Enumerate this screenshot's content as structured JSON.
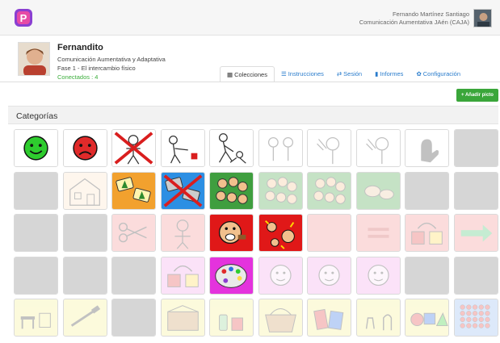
{
  "header": {
    "user_name": "Fernando Martínez Santiago",
    "user_org": "Comunicación Aumentativa JAén (CAJA)"
  },
  "profile": {
    "name": "Fernandito",
    "communication": "Comunicación Aumentativa y Adaptativa",
    "phase": "Fase 1 - El intercambio físico",
    "connected": "Conectados : 4"
  },
  "tabs": [
    {
      "label": "Colecciones",
      "icon": "grid-icon"
    },
    {
      "label": "Instrucciones",
      "icon": "list-icon"
    },
    {
      "label": "Sesión",
      "icon": "exchange-icon"
    },
    {
      "label": "Informes",
      "icon": "file-icon"
    },
    {
      "label": "Configuración",
      "icon": "gear-icon"
    }
  ],
  "add_button": "+ Añadir picto",
  "categories_title": "Categorías",
  "colors": {
    "accent_blue": "#2a7ccc",
    "add_green": "#3aa63a",
    "connected_green": "#3cae3c"
  },
  "grid": [
    [
      {
        "name": "happy-face-picto",
        "bg": "#ffffff",
        "icon": "happy",
        "faded": false
      },
      {
        "name": "sad-face-picto",
        "bg": "#ffffff",
        "icon": "sad",
        "faded": false
      },
      {
        "name": "no-picto",
        "bg": "#ffffff",
        "icon": "crossed-person",
        "faded": false
      },
      {
        "name": "give-picto",
        "bg": "#ffffff",
        "icon": "person-give",
        "faded": false
      },
      {
        "name": "help-picto",
        "bg": "#ffffff",
        "icon": "people-help",
        "faded": false
      },
      {
        "name": "faded-people-picto",
        "bg": "#ffffff",
        "icon": "people",
        "faded": true
      },
      {
        "name": "faded-hello-picto",
        "bg": "#ffffff",
        "icon": "wave",
        "faded": true
      },
      {
        "name": "faded-bye-picto",
        "bg": "#ffffff",
        "icon": "wave",
        "faded": true
      },
      {
        "name": "faded-hand-picto",
        "bg": "#ffffff",
        "icon": "hand",
        "faded": true
      },
      {
        "name": "empty-picto",
        "bg": "#d6d6d6",
        "icon": "none",
        "faded": false
      }
    ],
    [
      {
        "name": "empty-picto",
        "bg": "#d6d6d6",
        "icon": "none",
        "faded": false
      },
      {
        "name": "faded-house-picto",
        "bg": "#fbe0c2",
        "icon": "house",
        "faded": true
      },
      {
        "name": "trees-picto",
        "bg": "#f2a12e",
        "icon": "trees",
        "faded": false
      },
      {
        "name": "no-nature-picto",
        "bg": "#2c8fe3",
        "icon": "crossed-trees",
        "faded": false
      },
      {
        "name": "group-faces-picto",
        "bg": "#3f9e3f",
        "icon": "faces",
        "faded": false
      },
      {
        "name": "faded-group-picto",
        "bg": "#3f9e3f",
        "icon": "faces",
        "faded": true
      },
      {
        "name": "faded-crowd-picto",
        "bg": "#3f9e3f",
        "icon": "faces",
        "faded": true
      },
      {
        "name": "faded-animals-picto",
        "bg": "#3f9e3f",
        "icon": "animals",
        "faded": true
      },
      {
        "name": "empty-picto",
        "bg": "#d6d6d6",
        "icon": "none",
        "faded": false
      },
      {
        "name": "empty-picto",
        "bg": "#d6d6d6",
        "icon": "none",
        "faded": false
      }
    ],
    [
      {
        "name": "empty-picto",
        "bg": "#d6d6d6",
        "icon": "none",
        "faded": false
      },
      {
        "name": "empty-picto",
        "bg": "#d6d6d6",
        "icon": "none",
        "faded": false
      },
      {
        "name": "faded-scissors-picto",
        "bg": "#f08c8c",
        "icon": "scissors",
        "faded": true
      },
      {
        "name": "faded-person-picto",
        "bg": "#f08c8c",
        "icon": "person",
        "faded": true
      },
      {
        "name": "eat-picto",
        "bg": "#e01818",
        "icon": "eat",
        "faded": false
      },
      {
        "name": "angry-picto",
        "bg": "#e01818",
        "icon": "angry",
        "faded": false
      },
      {
        "name": "faded-red-picto",
        "bg": "#f08c8c",
        "icon": "none",
        "faded": true
      },
      {
        "name": "faded-equal-picto",
        "bg": "#f08c8c",
        "icon": "equal",
        "faded": true
      },
      {
        "name": "faded-change-picto",
        "bg": "#f08c8c",
        "icon": "squares",
        "faded": true
      },
      {
        "name": "faded-arrow-picto",
        "bg": "#f08c8c",
        "icon": "arrow",
        "faded": true
      }
    ],
    [
      {
        "name": "empty-picto",
        "bg": "#d6d6d6",
        "icon": "none",
        "faded": false
      },
      {
        "name": "empty-picto",
        "bg": "#d6d6d6",
        "icon": "none",
        "faded": false
      },
      {
        "name": "empty-picto",
        "bg": "#d6d6d6",
        "icon": "none",
        "faded": false
      },
      {
        "name": "faded-squares-picto",
        "bg": "#f19ee8",
        "icon": "squares",
        "faded": true
      },
      {
        "name": "palette-picto",
        "bg": "#e433dd",
        "icon": "palette",
        "faded": false
      },
      {
        "name": "faded-face-picto",
        "bg": "#f19ee8",
        "icon": "face",
        "faded": true
      },
      {
        "name": "faded-faces-picto",
        "bg": "#f19ee8",
        "icon": "face",
        "faded": true
      },
      {
        "name": "faded-smile-picto",
        "bg": "#f19ee8",
        "icon": "face",
        "faded": true
      },
      {
        "name": "empty-picto",
        "bg": "#d6d6d6",
        "icon": "none",
        "faded": false
      },
      {
        "name": "empty-picto",
        "bg": "#d6d6d6",
        "icon": "none",
        "faded": false
      }
    ],
    [
      {
        "name": "faded-furniture-picto",
        "bg": "#f3ee8c",
        "icon": "furniture",
        "faded": true
      },
      {
        "name": "faded-tools-picto",
        "bg": "#f3ee8c",
        "icon": "tools",
        "faded": true
      },
      {
        "name": "empty-picto",
        "bg": "#d6d6d6",
        "icon": "none",
        "faded": false
      },
      {
        "name": "faded-box-picto",
        "bg": "#f3ee8c",
        "icon": "box",
        "faded": true
      },
      {
        "name": "faded-food-picto",
        "bg": "#f3ee8c",
        "icon": "bottle",
        "faded": true
      },
      {
        "name": "faded-basket-picto",
        "bg": "#f3ee8c",
        "icon": "basket",
        "faded": true
      },
      {
        "name": "faded-books-picto",
        "bg": "#f3ee8c",
        "icon": "books",
        "faded": true
      },
      {
        "name": "faded-body-picto",
        "bg": "#f3ee8c",
        "icon": "body",
        "faded": true
      },
      {
        "name": "faded-shapes-picto",
        "bg": "#f3ee8c",
        "icon": "shapes",
        "faded": true
      },
      {
        "name": "faded-many-picto",
        "bg": "#8fb6ee",
        "icon": "dots",
        "faded": true
      }
    ]
  ]
}
